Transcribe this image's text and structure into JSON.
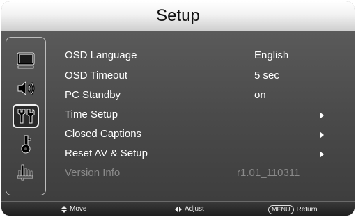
{
  "title": "Setup",
  "sidebar": {
    "icons": [
      {
        "name": "tv-icon",
        "active": false
      },
      {
        "name": "speaker-icon",
        "active": false
      },
      {
        "name": "tools-icon",
        "active": true
      },
      {
        "name": "key-lock-icon",
        "active": false
      },
      {
        "name": "antenna-icon",
        "active": false
      }
    ]
  },
  "menu": {
    "items": [
      {
        "label": "OSD Language",
        "value": "English",
        "submenu": false,
        "enabled": true
      },
      {
        "label": "OSD Timeout",
        "value": "5 sec",
        "submenu": false,
        "enabled": true
      },
      {
        "label": "PC Standby",
        "value": "on",
        "submenu": false,
        "enabled": true
      },
      {
        "label": "Time Setup",
        "value": "",
        "submenu": true,
        "enabled": true
      },
      {
        "label": "Closed Captions",
        "value": "",
        "submenu": true,
        "enabled": true
      },
      {
        "label": "Reset AV & Setup",
        "value": "",
        "submenu": true,
        "enabled": true
      },
      {
        "label": "Version  Info",
        "value": "r1.01_110311",
        "submenu": false,
        "enabled": false
      }
    ]
  },
  "statusbar": {
    "move_label": "Move",
    "adjust_label": "Adjust",
    "menu_key": "MENU",
    "return_label": "Return"
  },
  "colors": {
    "background": "#4d4d4d",
    "text": "#ffffff",
    "disabled_text": "#8a8a8a"
  }
}
